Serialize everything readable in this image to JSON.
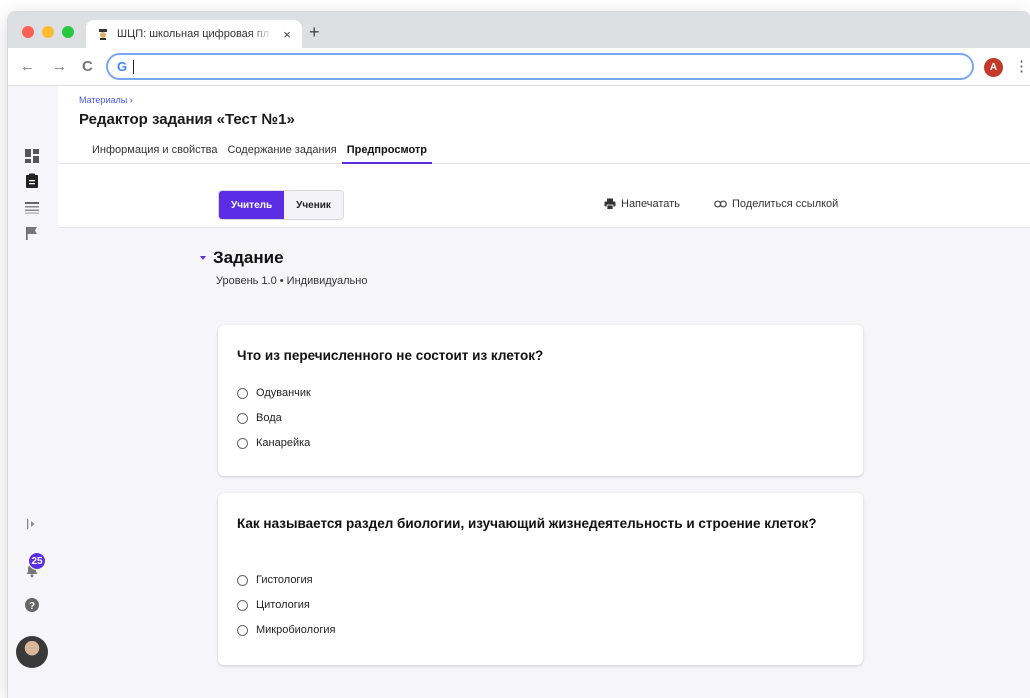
{
  "browser": {
    "tab_title": "ШЦП: школьная цифровая пл",
    "tab_close": "×",
    "new_tab": "+",
    "back": "←",
    "forward": "→",
    "reload": "C",
    "omnibox_logo": "G",
    "profile_initial": "A",
    "menu": "⋮"
  },
  "rail": {
    "notification_count": "25"
  },
  "header": {
    "breadcrumb": "Материалы ›",
    "title": "Редактор задания «Тест №1»",
    "tabs": [
      {
        "label": "Информация и свойства",
        "active": false
      },
      {
        "label": "Содержание задания",
        "active": false
      },
      {
        "label": "Предпросмотр",
        "active": true
      }
    ]
  },
  "preview_toolbar": {
    "modes": [
      {
        "label": "Учитель",
        "active": true
      },
      {
        "label": "Ученик",
        "active": false
      }
    ],
    "print_label": "Напечатать",
    "share_label": "Поделиться ссылкой"
  },
  "task": {
    "title": "Задание",
    "subtitle": "Уровень 1.0 • Индивидуально",
    "questions": [
      {
        "text": "Что из перечисленного не состоит из клеток?",
        "options": [
          "Одуванчик",
          "Вода",
          "Канарейка"
        ]
      },
      {
        "text": "Как называется раздел биологии, изучающий жизнедеятельность и строение клеток?",
        "options": [
          "Гистология",
          "Цитология",
          "Микробиология"
        ]
      }
    ]
  },
  "colors": {
    "accent": "#5b2ee6",
    "link": "#4a5be8",
    "background": "#f6f6f8"
  }
}
